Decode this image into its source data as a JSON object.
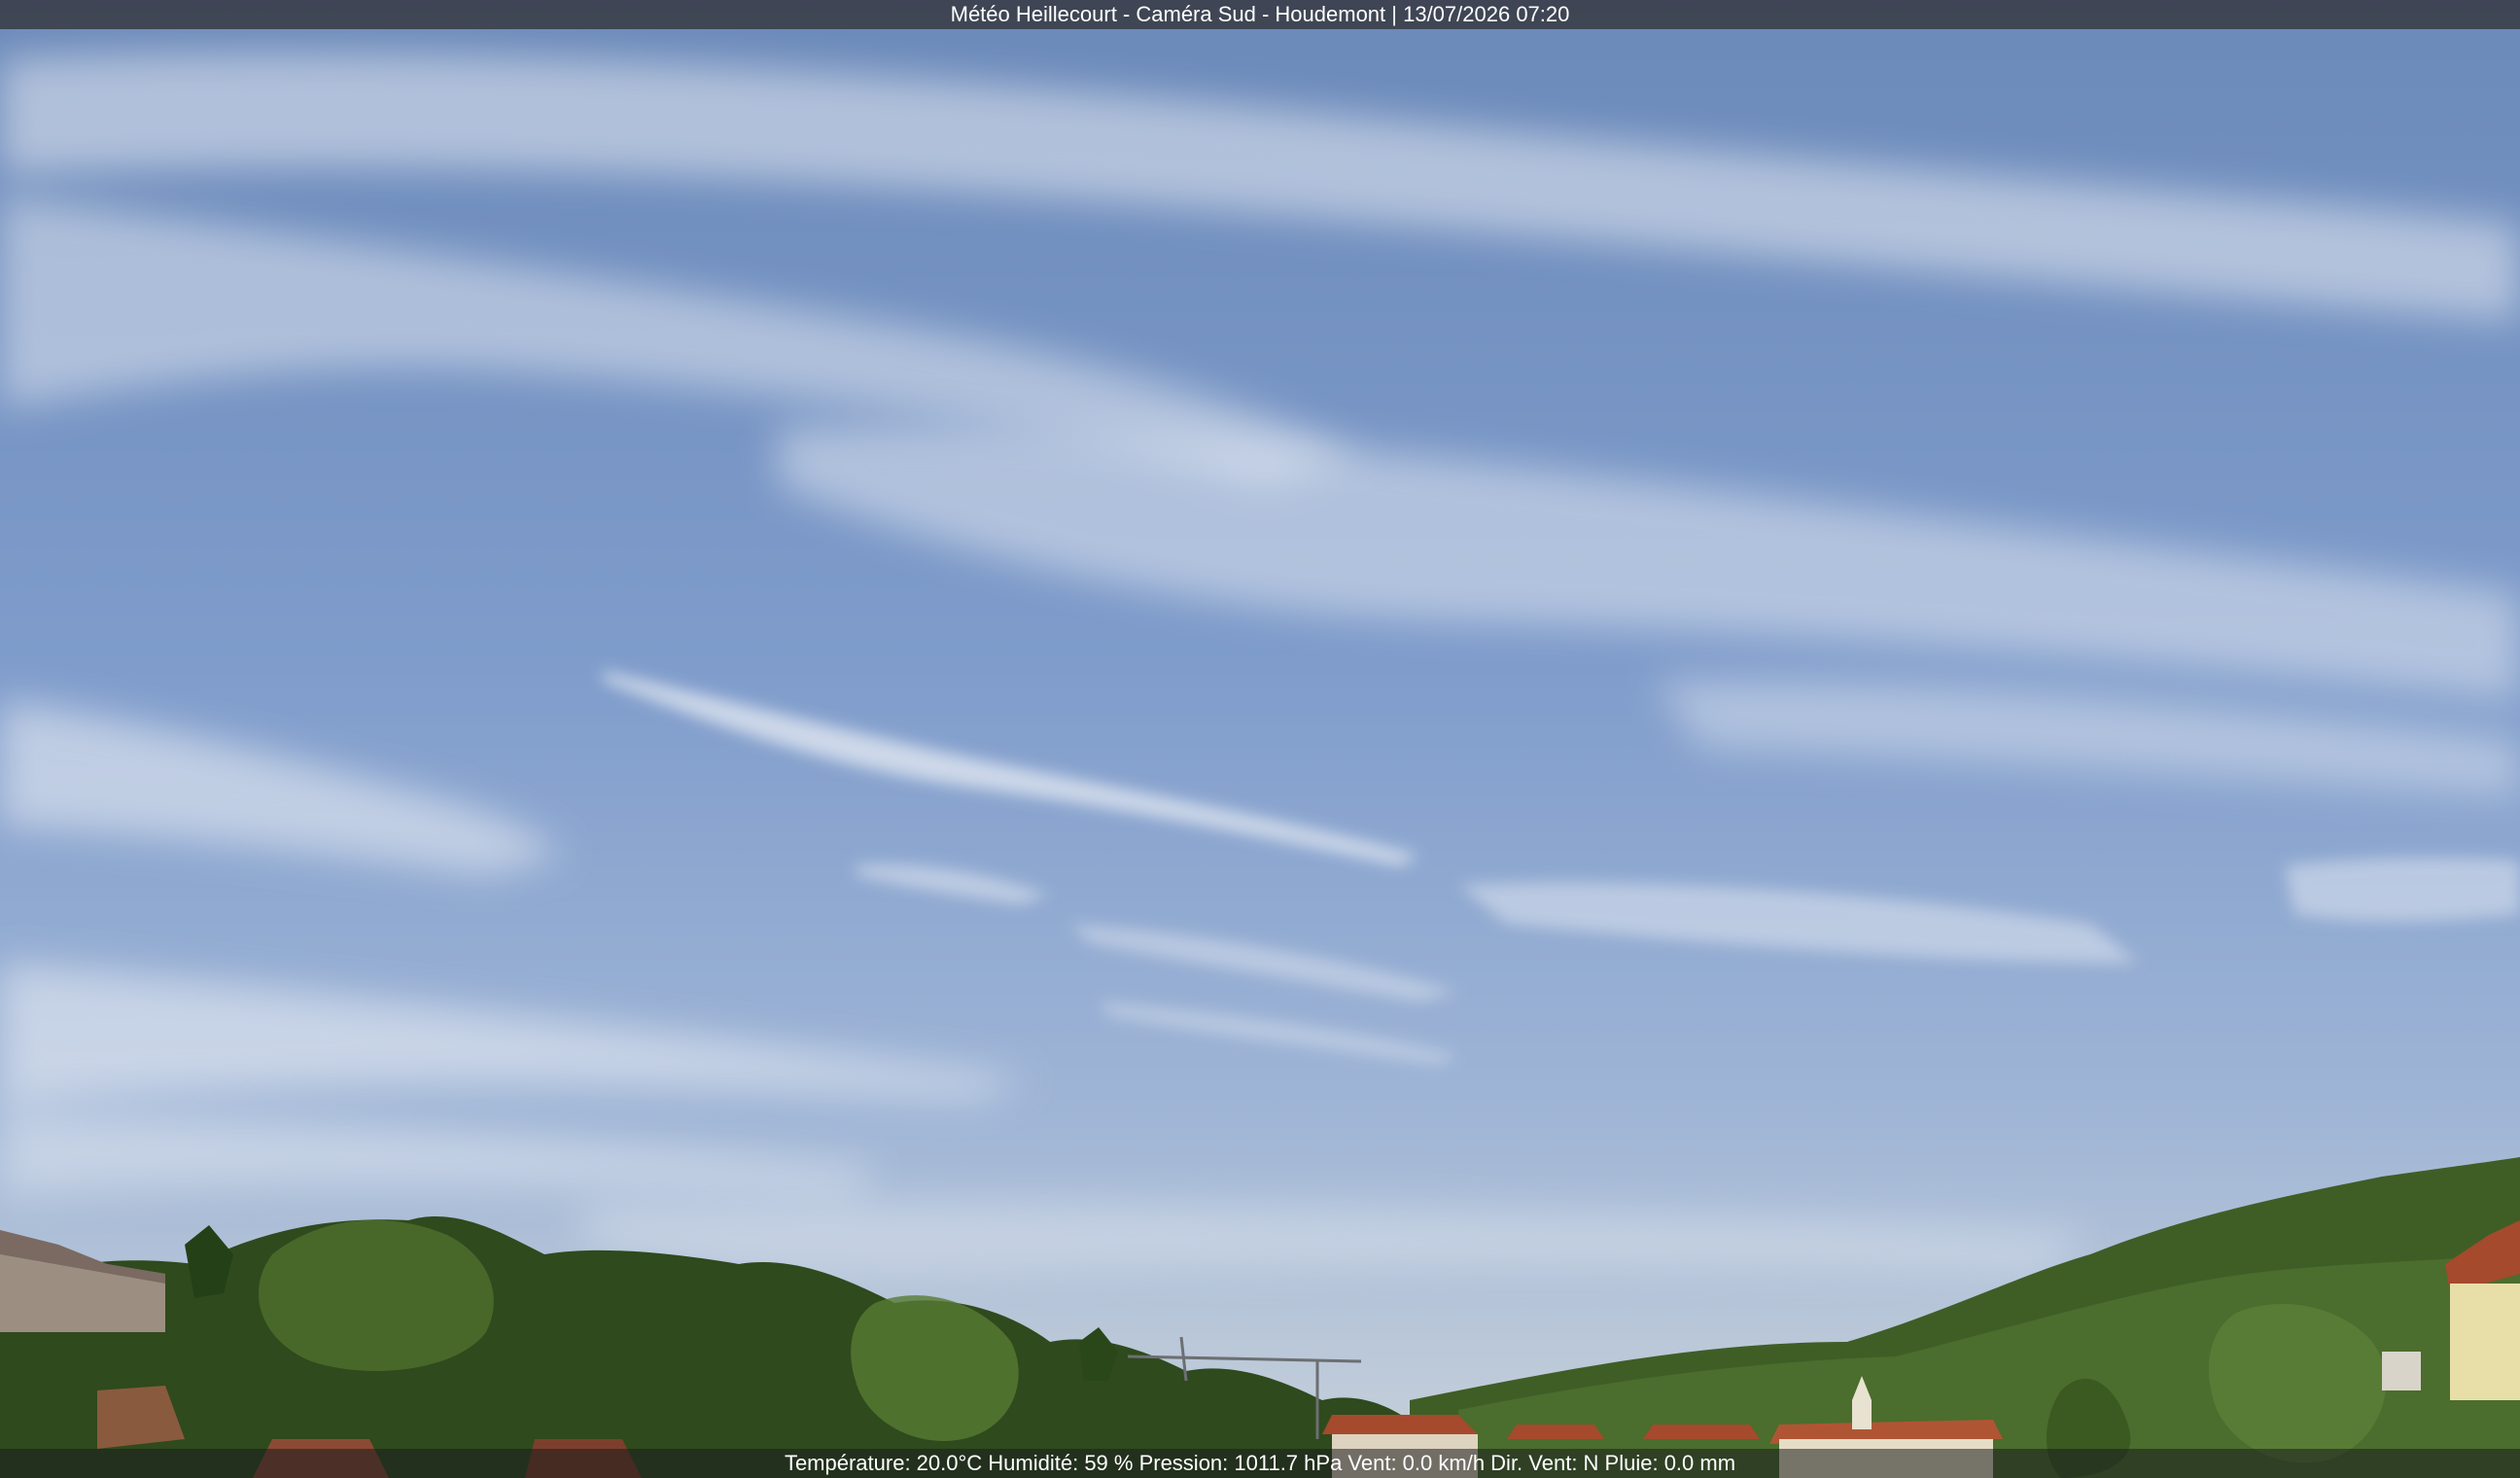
{
  "overlay": {
    "title": "Météo Heillecourt - Caméra Sud - Houdemont | 13/07/2026 07:20",
    "weather": "Température: 20.0°C  Humidité: 59 % Pression: 1011.7 hPa Vent: 0.0 km/h Dir. Vent: N Pluie: 0.0 mm"
  },
  "colors": {
    "sky_top": "#6d8cbc",
    "sky_mid": "#8fa8cf",
    "sky_horizon": "#c9d3dc",
    "foliage": "#3c5a24",
    "roof": "#a54a2c",
    "bar": "#373a42"
  }
}
